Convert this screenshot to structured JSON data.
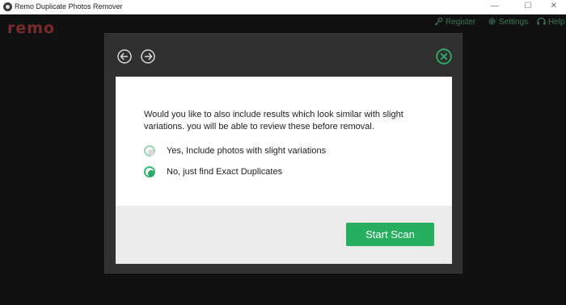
{
  "window": {
    "title": "Remo Duplicate Photos Remover",
    "controls": [
      "—",
      "☐",
      "✕"
    ]
  },
  "header": {
    "logo": "remo",
    "nav": [
      {
        "label": "Register",
        "icon": "key-icon"
      },
      {
        "label": "Settings",
        "icon": "gear-icon"
      },
      {
        "label": "Help",
        "icon": "help-icon"
      }
    ]
  },
  "dialog": {
    "back_icon": "arrow-left-icon",
    "forward_icon": "arrow-right-icon",
    "close_icon": "close-icon",
    "question": "Would you like to also include results which look similar with slight variations. you will be able to review these before removal.",
    "options": [
      {
        "label": "Yes, Include photos with slight variations",
        "selected": false
      },
      {
        "label": "No, just find Exact Duplicates",
        "selected": true
      }
    ],
    "start_button": "Start Scan"
  },
  "colors": {
    "accent": "#27ae5f",
    "dialog_frame": "#303030",
    "background": "#111111"
  }
}
